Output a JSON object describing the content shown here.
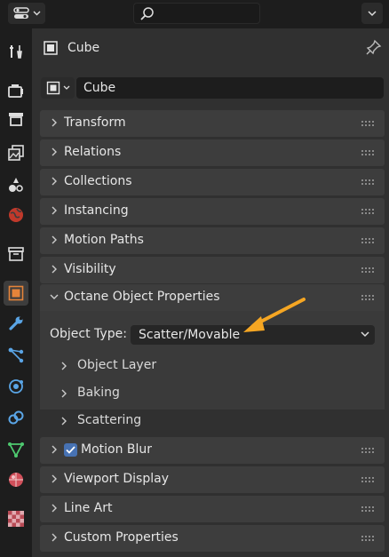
{
  "search": {
    "placeholder": ""
  },
  "header": {
    "object_name": "Cube"
  },
  "name_field": {
    "value": "Cube"
  },
  "sections_top": [
    {
      "label": "Transform"
    },
    {
      "label": "Relations"
    },
    {
      "label": "Collections"
    },
    {
      "label": "Instancing"
    },
    {
      "label": "Motion Paths"
    },
    {
      "label": "Visibility"
    }
  ],
  "octane": {
    "title": "Octane Object Properties",
    "object_type_label": "Object Type:",
    "object_type_value": "Scatter/Movable",
    "subpanels": [
      {
        "label": "Object Layer"
      },
      {
        "label": "Baking"
      },
      {
        "label": "Scattering"
      }
    ]
  },
  "sections_bottom": [
    {
      "label": "Motion Blur",
      "checked": true
    },
    {
      "label": "Viewport Display"
    },
    {
      "label": "Line Art"
    },
    {
      "label": "Custom Properties"
    }
  ],
  "tabs": [
    {
      "icon": "tool-icon"
    },
    {
      "icon": "render-icon"
    },
    {
      "icon": "output-icon"
    },
    {
      "icon": "view-layer-icon"
    },
    {
      "icon": "scene-icon"
    },
    {
      "icon": "world-icon"
    },
    {
      "icon": "collection-icon"
    },
    {
      "icon": "object-icon",
      "active": true
    },
    {
      "icon": "modifier-icon"
    },
    {
      "icon": "particles-icon"
    },
    {
      "icon": "physics-icon"
    },
    {
      "icon": "constraints-icon"
    },
    {
      "icon": "object-data-icon"
    },
    {
      "icon": "material-icon"
    },
    {
      "icon": "texture-icon"
    }
  ],
  "colors": {
    "accent": "#f5a623",
    "checkbox": "#4772b3",
    "active_icon": "#e5843a"
  }
}
